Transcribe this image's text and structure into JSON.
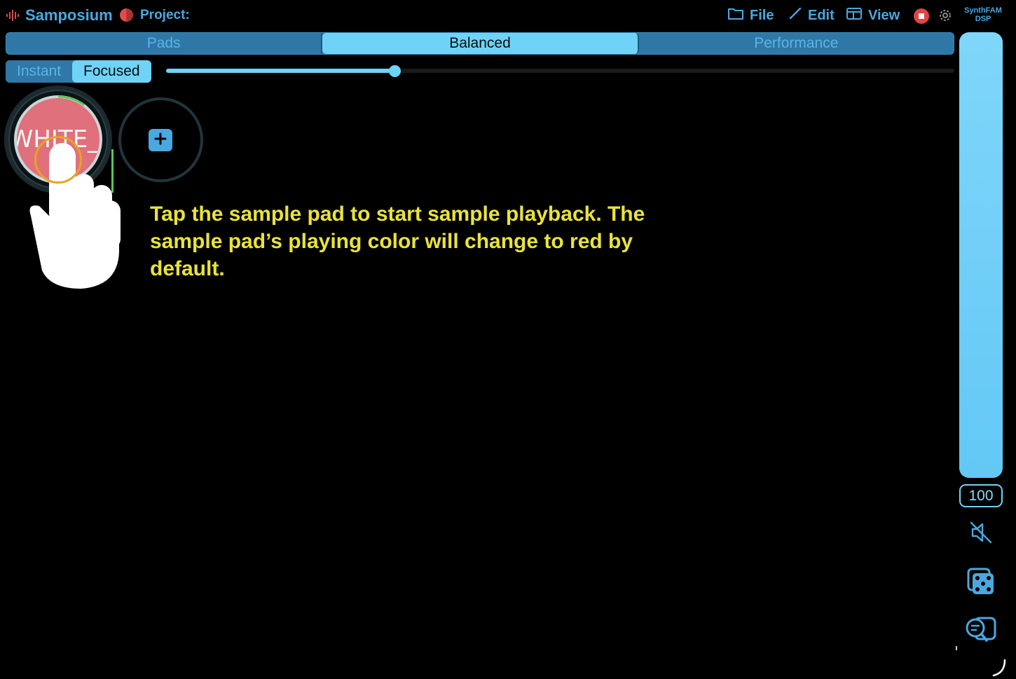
{
  "app": {
    "name": "Samposium",
    "project_label": "Project:",
    "brand_top": "SynthFAM",
    "brand_bottom": "DSP"
  },
  "menu": {
    "file": "File",
    "edit": "Edit",
    "view": "View"
  },
  "mode_tabs": [
    {
      "label": "Pads",
      "active": false
    },
    {
      "label": "Balanced",
      "active": true
    },
    {
      "label": "Performance",
      "active": false
    }
  ],
  "sub_tabs": [
    {
      "label": "Instant",
      "active": false
    },
    {
      "label": "Focused",
      "active": true
    }
  ],
  "slider": {
    "value": 0.29
  },
  "pads": [
    {
      "label": "WHITE_I",
      "playing": true,
      "color": "#e0707c"
    }
  ],
  "tutorial": {
    "text": "Tap the sample pad to start sample playback. The sample pad’s playing color will change to red by default."
  },
  "volume": {
    "value": "100",
    "level": 1.0
  },
  "icons": {
    "app_logo": "waveform-icon",
    "project": "project-state-icon",
    "file": "folder-icon",
    "edit": "pencil-icon",
    "view": "layout-icon",
    "record": "stop-record-icon",
    "settings": "gear-icon",
    "mute": "speaker-muted-icon",
    "random": "dice-icon",
    "search": "search-chat-icon",
    "add_pad": "plus-icon",
    "hand": "tap-hand-icon"
  },
  "colors": {
    "accent": "#4aa8e0",
    "active_tab": "#6fd3f8",
    "record": "#e04444",
    "tutorial_text": "#e9e33a",
    "tap_ring": "#e8a321"
  }
}
